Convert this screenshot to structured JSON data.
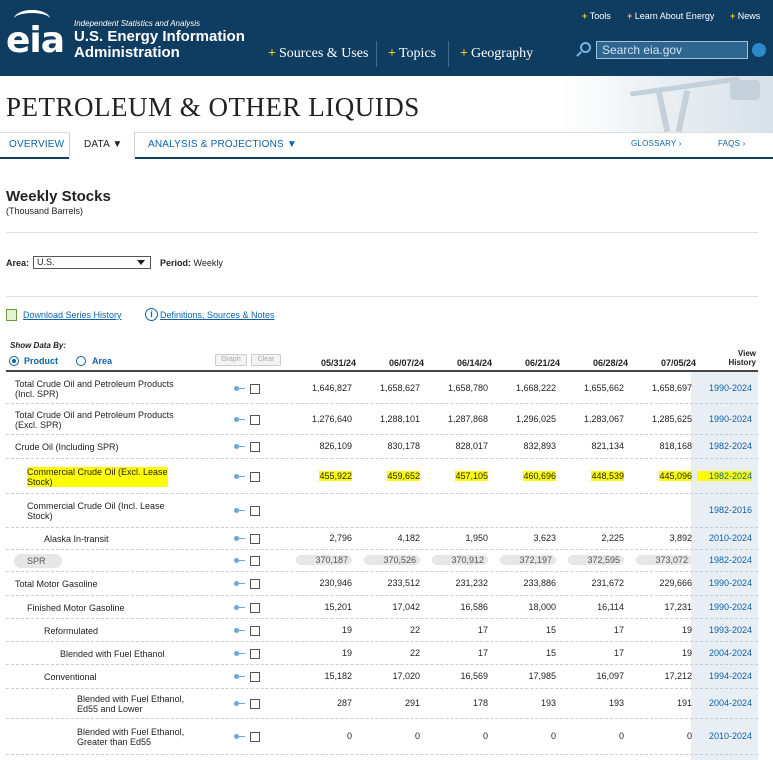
{
  "header": {
    "logo": "eia",
    "tagline": "Independent Statistics and Analysis",
    "brand_line1": "U.S. Energy Information",
    "brand_line2": "Administration",
    "nav": [
      "Sources & Uses",
      "Topics",
      "Geography"
    ],
    "utility": [
      "Tools",
      "Learn About Energy",
      "News"
    ],
    "search_placeholder": "Search eia.gov"
  },
  "page_title": "PETROLEUM & OTHER LIQUIDS",
  "subnav": {
    "overview": "OVERVIEW",
    "data": "DATA",
    "analysis": "ANALYSIS & PROJECTIONS",
    "glossary": "GLOSSARY",
    "faqs": "FAQS"
  },
  "section": {
    "title": "Weekly Stocks",
    "units": "(Thousand Barrels)",
    "area_label": "Area:",
    "area_value": "U.S.",
    "period_label": "Period:",
    "period_value": "Weekly",
    "download_link": "Download Series History",
    "definitions_link": "Definitions, Sources & Notes"
  },
  "table": {
    "show_by": "Show Data By:",
    "radio_product": "Product",
    "radio_area": "Area",
    "graph_btn": "Graph",
    "clear_btn": "Clear",
    "columns": [
      "05/31/24",
      "06/07/24",
      "06/14/24",
      "06/21/24",
      "06/28/24",
      "07/05/24"
    ],
    "view_history_1": "View",
    "view_history_2": "History",
    "rows": [
      {
        "l1": "Total Crude Oil and Petroleum Products",
        "l2": "(Incl. SPR)",
        "v": [
          "1,646,827",
          "1,658,627",
          "1,658,780",
          "1,668,222",
          "1,655,662",
          "1,658,697"
        ],
        "h": "1990-2024"
      },
      {
        "l1": "Total Crude Oil and Petroleum Products",
        "l2": "(Excl. SPR)",
        "v": [
          "1,276,640",
          "1,288,101",
          "1,287,868",
          "1,296,025",
          "1,283,067",
          "1,285,625"
        ],
        "h": "1990-2024"
      },
      {
        "l1": "Crude Oil (Including SPR)",
        "l2": "",
        "v": [
          "826,109",
          "830,178",
          "828,017",
          "832,893",
          "821,134",
          "818,168"
        ],
        "h": "1982-2024"
      },
      {
        "l1": "Commercial Crude Oil (Excl. Lease",
        "l2": "Stock)",
        "v": [
          "455,922",
          "459,652",
          "457,105",
          "460,696",
          "448,539",
          "445,096"
        ],
        "h": "1982-2024"
      },
      {
        "l1": "Commercial Crude Oil (Incl. Lease",
        "l2": "Stock)",
        "v": [
          "",
          "",
          "",
          "",
          "",
          ""
        ],
        "h": "1982-2016"
      },
      {
        "l1": "Alaska In-transit",
        "l2": "",
        "v": [
          "2,796",
          "4,182",
          "1,950",
          "3,623",
          "2,225",
          "3,892"
        ],
        "h": "2010-2024"
      },
      {
        "l1": "SPR",
        "l2": "",
        "v": [
          "370,187",
          "370,526",
          "370,912",
          "372,197",
          "372,595",
          "373,072"
        ],
        "h": "1982-2024"
      },
      {
        "l1": "Total Motor Gasoline",
        "l2": "",
        "v": [
          "230,946",
          "233,512",
          "231,232",
          "233,886",
          "231,672",
          "229,666"
        ],
        "h": "1990-2024"
      },
      {
        "l1": "Finished Motor Gasoline",
        "l2": "",
        "v": [
          "15,201",
          "17,042",
          "16,586",
          "18,000",
          "16,114",
          "17,231"
        ],
        "h": "1990-2024"
      },
      {
        "l1": "Reformulated",
        "l2": "",
        "v": [
          "19",
          "22",
          "17",
          "15",
          "17",
          "19"
        ],
        "h": "1993-2024"
      },
      {
        "l1": "Blended with Fuel Ethanol",
        "l2": "",
        "v": [
          "19",
          "22",
          "17",
          "15",
          "17",
          "19"
        ],
        "h": "2004-2024"
      },
      {
        "l1": "Conventional",
        "l2": "",
        "v": [
          "15,182",
          "17,020",
          "16,569",
          "17,985",
          "16,097",
          "17,212"
        ],
        "h": "1994-2024"
      },
      {
        "l1": "Blended with Fuel Ethanol,",
        "l2": "Ed55 and Lower",
        "v": [
          "287",
          "291",
          "178",
          "193",
          "193",
          "191"
        ],
        "h": "2004-2024"
      },
      {
        "l1": "Blended with Fuel Ethanol,",
        "l2": "Greater than Ed55",
        "v": [
          "0",
          "0",
          "0",
          "0",
          "0",
          "0"
        ],
        "h": "2010-2024"
      }
    ]
  }
}
